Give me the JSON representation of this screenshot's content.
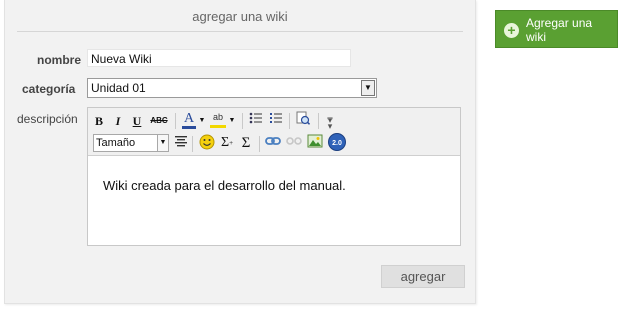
{
  "panel": {
    "title": "agregar una wiki"
  },
  "form": {
    "name_label": "nombre",
    "name_value": "Nueva Wiki",
    "category_label": "categoría",
    "category_value": "Unidad 01",
    "description_label": "descripción",
    "description_text": "Wiki creada para el desarrollo del manual.",
    "size_select": "Tamaño",
    "submit_label": "agregar"
  },
  "toolbar": {
    "bold": "B",
    "italic": "I",
    "underline": "U",
    "strike": "ABC",
    "font_color": "A",
    "highlight": "ab",
    "sum": "Σ",
    "version_badge": "2.0"
  },
  "side_button": {
    "label": "Agregar una wiki"
  },
  "colors": {
    "accent_green": "#5aa032",
    "panel_bg": "#f2f2f2"
  }
}
